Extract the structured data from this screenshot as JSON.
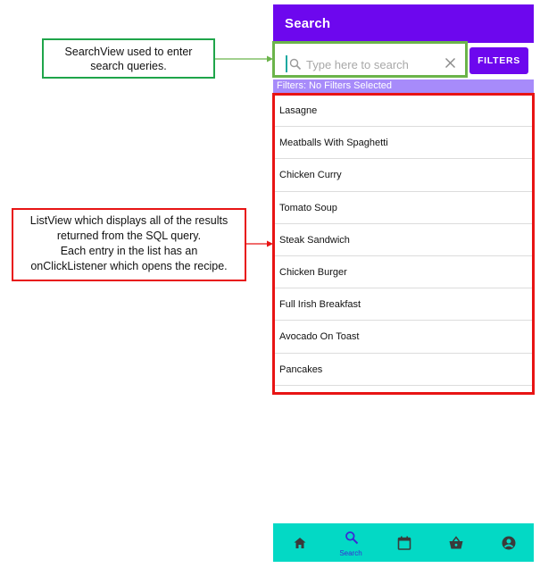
{
  "app": {
    "title": "Search"
  },
  "search": {
    "placeholder": "Type here to search",
    "value": "",
    "filters_label": "FILTERS"
  },
  "filters_status": "Filters: No Filters Selected",
  "results": [
    "Lasagne",
    "Meatballs With Spaghetti",
    "Chicken Curry",
    "Tomato Soup",
    "Steak Sandwich",
    "Chicken Burger",
    "Full Irish Breakfast",
    "Avocado On Toast",
    "Pancakes"
  ],
  "bottom_nav": {
    "items": [
      {
        "icon": "home-icon",
        "label": ""
      },
      {
        "icon": "search-icon",
        "label": "Search",
        "active": true
      },
      {
        "icon": "calendar-icon",
        "label": ""
      },
      {
        "icon": "basket-icon",
        "label": ""
      },
      {
        "icon": "account-icon",
        "label": ""
      }
    ]
  },
  "annotations": {
    "searchview": {
      "lines": [
        "SearchView used to enter",
        "search queries."
      ],
      "color": "#1fa54a"
    },
    "listview": {
      "lines": [
        "ListView which displays all of the results",
        "returned from the SQL query.",
        "Each entry in the list has an",
        "onClickListener which opens the recipe."
      ],
      "color": "#e81414"
    }
  },
  "colors": {
    "primary": "#6d07ee",
    "filter_bar": "#a78bfa",
    "bottom_nav": "#03d9c5",
    "nav_active": "#3b2ad6"
  }
}
